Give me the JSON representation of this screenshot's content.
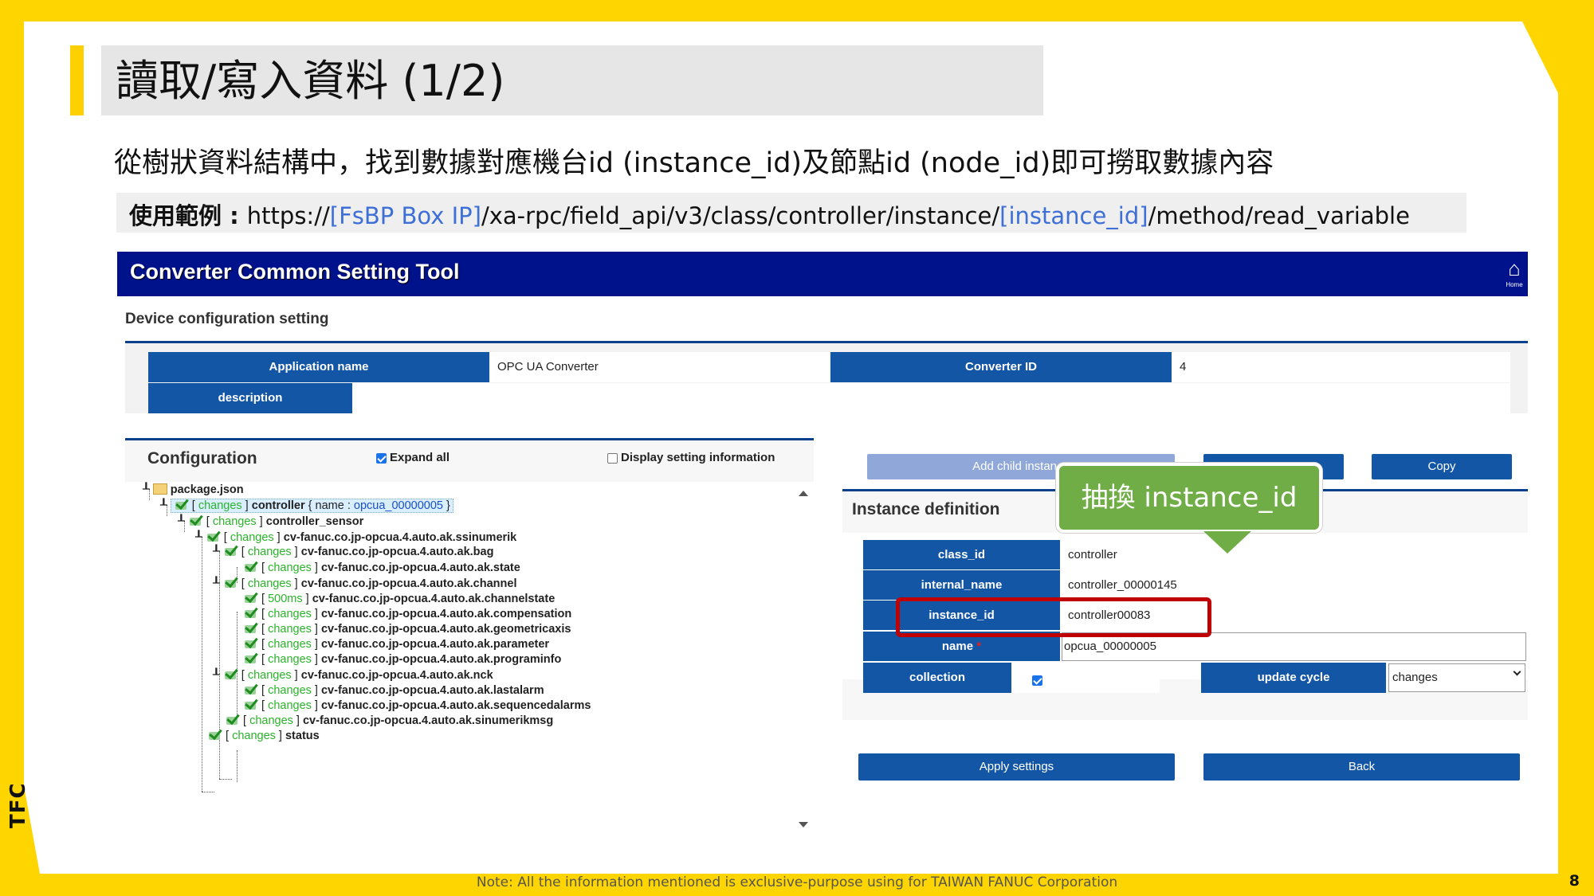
{
  "slide": {
    "title": "讀取/寫入資料 (1/2)",
    "subtitle": "從樹狀資料結構中，找到數據對應機台id (instance_id)及節點id (node_id)即可撈取數據內容",
    "example_label": "使用範例 : ",
    "example_part1": "https://",
    "example_link1": "[FsBP Box IP]",
    "example_part2": "/xa-rpc/field_api/v3/class/controller/instance/",
    "example_link2": "[instance_id]",
    "example_part3": "/method/read_variable",
    "brand": "TFC",
    "footer": "Note: All the information mentioned is exclusive-purpose using for TAIWAN FANUC Corporation",
    "page_number": "8",
    "callout": "抽換 instance_id"
  },
  "app": {
    "title": "Converter Common Setting Tool",
    "home_label": "Home",
    "section_title": "Device configuration setting",
    "application_name_label": "Application name",
    "application_name_value": "OPC UA Converter",
    "converter_id_label": "Converter ID",
    "converter_id_value": "4",
    "description_label": "description",
    "description_value": ""
  },
  "configuration": {
    "title": "Configuration",
    "expand_all": "Expand all",
    "display_setting": "Display setting information",
    "tree": [
      {
        "tag": "",
        "name": "package.json"
      },
      {
        "tag": "changes",
        "name": "controller",
        "extra_key": "name",
        "extra_value": "opcua_00000005"
      },
      {
        "tag": "changes",
        "name": "controller_sensor"
      },
      {
        "tag": "changes",
        "name": "cv-fanuc.co.jp-opcua.4.auto.ak.ssinumerik"
      },
      {
        "tag": "changes",
        "name": "cv-fanuc.co.jp-opcua.4.auto.ak.bag"
      },
      {
        "tag": "changes",
        "name": "cv-fanuc.co.jp-opcua.4.auto.ak.state"
      },
      {
        "tag": "changes",
        "name": "cv-fanuc.co.jp-opcua.4.auto.ak.channel"
      },
      {
        "tag": "500ms",
        "name": "cv-fanuc.co.jp-opcua.4.auto.ak.channelstate"
      },
      {
        "tag": "changes",
        "name": "cv-fanuc.co.jp-opcua.4.auto.ak.compensation"
      },
      {
        "tag": "changes",
        "name": "cv-fanuc.co.jp-opcua.4.auto.ak.geometricaxis"
      },
      {
        "tag": "changes",
        "name": "cv-fanuc.co.jp-opcua.4.auto.ak.parameter"
      },
      {
        "tag": "changes",
        "name": "cv-fanuc.co.jp-opcua.4.auto.ak.programinfo"
      },
      {
        "tag": "changes",
        "name": "cv-fanuc.co.jp-opcua.4.auto.ak.nck"
      },
      {
        "tag": "changes",
        "name": "cv-fanuc.co.jp-opcua.4.auto.ak.lastalarm"
      },
      {
        "tag": "changes",
        "name": "cv-fanuc.co.jp-opcua.4.auto.ak.sequencedalarms"
      },
      {
        "tag": "changes",
        "name": "cv-fanuc.co.jp-opcua.4.auto.ak.sinumerikmsg"
      },
      {
        "tag": "changes",
        "name": "status"
      }
    ]
  },
  "instance": {
    "add_child": "Add child instance",
    "middle_button": "",
    "copy": "Copy",
    "title": "Instance definition",
    "class_id_label": "class_id",
    "class_id_value": "controller",
    "internal_name_label": "internal_name",
    "internal_name_value": "controller_00000145",
    "instance_id_label": "instance_id",
    "instance_id_value": "controller00083",
    "name_label": "name",
    "required_mark": "*",
    "name_value": "opcua_00000005",
    "collection_label": "collection",
    "update_cycle_label": "update cycle",
    "update_cycle_value": "changes",
    "apply": "Apply settings",
    "back": "Back"
  }
}
